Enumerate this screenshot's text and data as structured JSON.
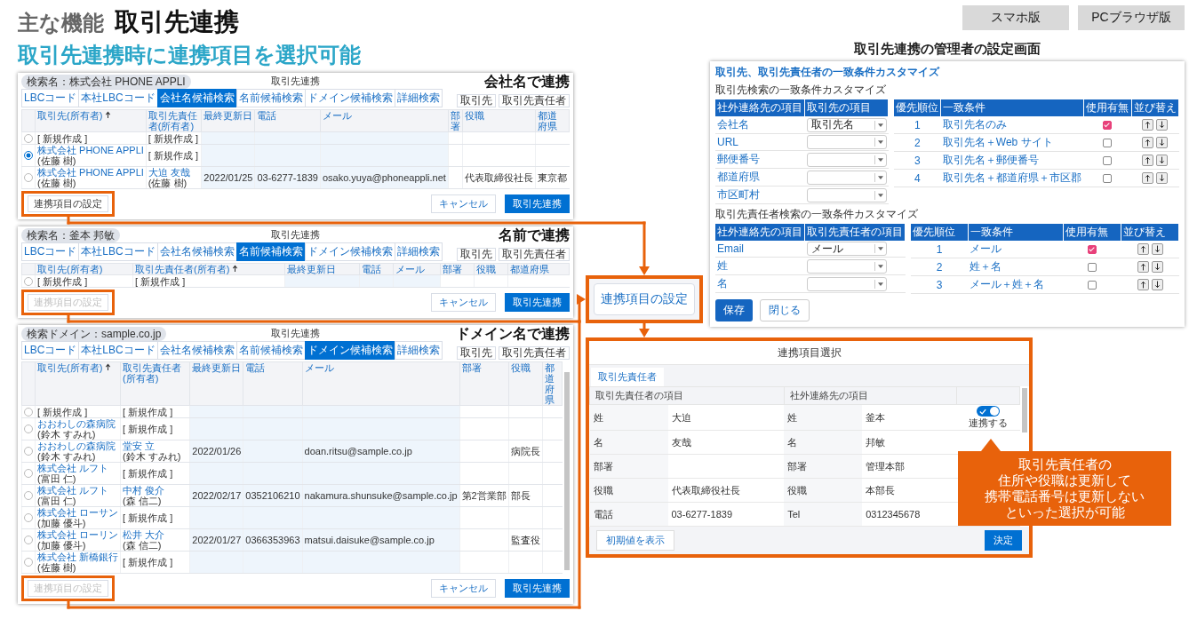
{
  "header": {
    "category": "主な機能",
    "title": "取引先連携",
    "buttons": [
      {
        "label": "スマホ版"
      },
      {
        "label": "PCブラウザ版"
      }
    ]
  },
  "subtitle": "取引先連携時に連携項目を選択可能",
  "screens": [
    {
      "caption": "会社名で連携",
      "title": "取引先連携",
      "tabs": [
        {
          "label": "LBCコード",
          "selected": false
        },
        {
          "label": "本社LBCコード",
          "selected": false
        },
        {
          "label": "会社名候補検索",
          "selected": true
        },
        {
          "label": "名前候補検索",
          "selected": false
        },
        {
          "label": "ドメイン候補検索",
          "selected": false
        },
        {
          "label": "詳細検索",
          "selected": false
        }
      ],
      "search_chip": "検索名：株式会社 PHONE APPLI",
      "filters": [
        "取引先",
        "取引先責任者"
      ],
      "columns": [
        {
          "label": "取引先(所有者)",
          "sorted": true
        },
        {
          "label": "取引先責任者(所有者)",
          "sorted": false
        },
        {
          "label": "最終更新日",
          "sorted": false
        },
        {
          "label": "電話",
          "sorted": false
        },
        {
          "label": "メール",
          "sorted": false
        },
        {
          "label": "部署",
          "sorted": false
        },
        {
          "label": "役職",
          "sorted": false
        },
        {
          "label": "都道府県",
          "sorted": false
        }
      ],
      "rows": [
        {
          "selected": false,
          "cells": [
            {
              "text": "[ 新規作成 ]",
              "kind": "text"
            },
            {
              "text": "[ 新規作成 ]",
              "kind": "text"
            },
            null,
            null,
            null,
            null,
            null,
            null
          ]
        },
        {
          "selected": true,
          "cells": [
            {
              "text": "株式会社 PHONE APPLI",
              "note": "(佐藤 樹)",
              "kind": "link"
            },
            {
              "text": "[ 新規作成 ]",
              "kind": "text"
            },
            null,
            null,
            null,
            null,
            null,
            null
          ]
        },
        {
          "selected": false,
          "cells": [
            {
              "text": "株式会社 PHONE APPLI",
              "note": "(佐藤 樹)",
              "kind": "link"
            },
            {
              "text": "大迫 友哉",
              "note": "(佐藤 樹)",
              "kind": "link"
            },
            {
              "text": "2022/01/25",
              "kind": "text"
            },
            {
              "text": "03-6277-1839",
              "kind": "text"
            },
            {
              "text": "osako.yuya@phoneappli.net",
              "kind": "text"
            },
            null,
            {
              "text": "代表取締役社長",
              "kind": "text"
            },
            {
              "text": "東京都",
              "kind": "text"
            }
          ]
        }
      ],
      "settings_button": {
        "label": "連携項目の設定",
        "disabled": false
      },
      "cancel": "キャンセル",
      "confirm": "取引先連携"
    },
    {
      "caption": "名前で連携",
      "title": "取引先連携",
      "tabs": [
        {
          "label": "LBCコード",
          "selected": false
        },
        {
          "label": "本社LBCコード",
          "selected": false
        },
        {
          "label": "会社名候補検索",
          "selected": false
        },
        {
          "label": "名前候補検索",
          "selected": true
        },
        {
          "label": "ドメイン候補検索",
          "selected": false
        },
        {
          "label": "詳細検索",
          "selected": false
        }
      ],
      "search_chip": "検索名：釜本 邦敏",
      "filters": [
        "取引先",
        "取引先責任者"
      ],
      "columns": [
        {
          "label": "取引先(所有者)",
          "sorted": false
        },
        {
          "label": "取引先責任者(所有者)",
          "sorted": true
        },
        {
          "label": "最終更新日",
          "sorted": false
        },
        {
          "label": "電話",
          "sorted": false
        },
        {
          "label": "メール",
          "sorted": false
        },
        {
          "label": "部署",
          "sorted": false
        },
        {
          "label": "役職",
          "sorted": false
        },
        {
          "label": "都道府県",
          "sorted": false
        }
      ],
      "rows": [
        {
          "selected": false,
          "cells": [
            {
              "text": "[ 新規作成 ]",
              "kind": "text"
            },
            {
              "text": "[ 新規作成 ]",
              "kind": "text"
            },
            null,
            null,
            null,
            null,
            null,
            null
          ]
        }
      ],
      "settings_button": {
        "label": "連携項目の設定",
        "disabled": true
      },
      "cancel": "キャンセル",
      "confirm": "取引先連携"
    },
    {
      "caption": "ドメイン名で連携",
      "title": "取引先連携",
      "tabs": [
        {
          "label": "LBCコード",
          "selected": false
        },
        {
          "label": "本社LBCコード",
          "selected": false
        },
        {
          "label": "会社名候補検索",
          "selected": false
        },
        {
          "label": "名前候補検索",
          "selected": false
        },
        {
          "label": "ドメイン候補検索",
          "selected": true
        },
        {
          "label": "詳細検索",
          "selected": false
        }
      ],
      "search_chip": "検索ドメイン：sample.co.jp",
      "filters": [
        "取引先",
        "取引先責任者"
      ],
      "columns": [
        {
          "label": "取引先(所有者)",
          "sorted": true
        },
        {
          "label": "取引先責任者(所有者)",
          "sorted": false
        },
        {
          "label": "最終更新日",
          "sorted": false
        },
        {
          "label": "電話",
          "sorted": false
        },
        {
          "label": "メール",
          "sorted": false
        },
        {
          "label": "部署",
          "sorted": false
        },
        {
          "label": "役職",
          "sorted": false
        },
        {
          "label": "都道府県",
          "sorted": false
        }
      ],
      "rows": [
        {
          "selected": false,
          "cells": [
            {
              "text": "[ 新規作成 ]",
              "kind": "text"
            },
            {
              "text": "[ 新規作成 ]",
              "kind": "text"
            },
            null,
            null,
            null,
            null,
            null,
            null
          ]
        },
        {
          "selected": false,
          "cells": [
            {
              "text": "おおわしの森病院",
              "note": "(鈴木 すみれ)",
              "kind": "link"
            },
            {
              "text": "[ 新規作成 ]",
              "kind": "text"
            },
            null,
            null,
            null,
            null,
            null,
            null
          ]
        },
        {
          "selected": false,
          "cells": [
            {
              "text": "おおわしの森病院",
              "note": "(鈴木 すみれ)",
              "kind": "link"
            },
            {
              "text": "堂安 立",
              "note": "(鈴木 すみれ)",
              "kind": "link"
            },
            {
              "text": "2022/01/26",
              "kind": "text"
            },
            null,
            {
              "text": "doan.ritsu@sample.co.jp",
              "kind": "text"
            },
            null,
            {
              "text": "病院長",
              "kind": "text"
            },
            null
          ]
        },
        {
          "selected": false,
          "cells": [
            {
              "text": "株式会社 ルフト",
              "note": "(富田 仁)",
              "kind": "link"
            },
            {
              "text": "[ 新規作成 ]",
              "kind": "text"
            },
            null,
            null,
            null,
            null,
            null,
            null
          ]
        },
        {
          "selected": false,
          "cells": [
            {
              "text": "株式会社 ルフト",
              "note": "(富田 仁)",
              "kind": "link"
            },
            {
              "text": "中村 俊介",
              "note": "(森 信二)",
              "kind": "link"
            },
            {
              "text": "2022/02/17",
              "kind": "text"
            },
            {
              "text": "0352106210",
              "kind": "text"
            },
            {
              "text": "nakamura.shunsuke@sample.co.jp",
              "kind": "text"
            },
            {
              "text": "第2営業部",
              "kind": "text"
            },
            {
              "text": "部長",
              "kind": "text"
            },
            null
          ]
        },
        {
          "selected": false,
          "cells": [
            {
              "text": "株式会社 ローサン",
              "note": "(加藤 優斗)",
              "kind": "link"
            },
            {
              "text": "[ 新規作成 ]",
              "kind": "text"
            },
            null,
            null,
            null,
            null,
            null,
            null
          ]
        },
        {
          "selected": false,
          "cells": [
            {
              "text": "株式会社 ローリン",
              "note": "(加藤 優斗)",
              "kind": "link"
            },
            {
              "text": "松井 大介",
              "note": "(森 信二)",
              "kind": "link"
            },
            {
              "text": "2022/01/27",
              "kind": "text"
            },
            {
              "text": "0366353963",
              "kind": "text"
            },
            {
              "text": "matsui.daisuke@sample.co.jp",
              "kind": "text"
            },
            null,
            {
              "text": "監査役",
              "kind": "text"
            },
            null
          ]
        },
        {
          "selected": false,
          "cells": [
            {
              "text": "株式会社 新橋銀行",
              "note": "(佐藤 樹)",
              "kind": "link"
            },
            {
              "text": "[ 新規作成 ]",
              "kind": "text"
            },
            null,
            null,
            null,
            null,
            null,
            null
          ]
        }
      ],
      "settings_button": {
        "label": "連携項目の設定",
        "disabled": true
      },
      "cancel": "キャンセル",
      "confirm": "取引先連携"
    }
  ],
  "settings_entry": {
    "label": "連携項目の設定"
  },
  "admin": {
    "caption": "取引先連携の管理者の設定画面",
    "title": "取引先、取引先責任者の一致条件カスタマイズ",
    "sections": [
      {
        "heading": "取引先検索の一致条件カスタマイズ",
        "map_columns": [
          "社外連絡先の項目",
          "取引先の項目"
        ],
        "mappings": [
          {
            "field": "会社名",
            "value": "取引先名"
          },
          {
            "field": "URL"
          },
          {
            "field": "郵便番号"
          },
          {
            "field": "都道府県"
          },
          {
            "field": "市区町村"
          }
        ],
        "rule_columns": [
          "優先順位",
          "一致条件",
          "使用有無",
          "並び替え"
        ],
        "rules": [
          {
            "rank": "1",
            "condition": "取引先名のみ",
            "checked": true
          },
          {
            "rank": "2",
            "condition": "取引先名＋Web サイト",
            "checked": false
          },
          {
            "rank": "3",
            "condition": "取引先名＋郵便番号",
            "checked": false
          },
          {
            "rank": "4",
            "condition": "取引先名＋都道府県＋市区郡",
            "checked": false
          }
        ]
      },
      {
        "heading": "取引先責任者検索の一致条件カスタマイズ",
        "map_columns": [
          "社外連絡先の項目",
          "取引先責任者の項目"
        ],
        "mappings": [
          {
            "field": "Email",
            "value": "メール"
          },
          {
            "field": "姓"
          },
          {
            "field": "名"
          }
        ],
        "rule_columns": [
          "優先順位",
          "一致条件",
          "使用有無",
          "並び替え"
        ],
        "rules": [
          {
            "rank": "1",
            "condition": "メール",
            "checked": true
          },
          {
            "rank": "2",
            "condition": "姓＋名",
            "checked": false
          },
          {
            "rank": "3",
            "condition": "メール＋姓＋名",
            "checked": false
          }
        ]
      }
    ],
    "buttons": [
      {
        "label": "保存",
        "primary": true
      },
      {
        "label": "閉じる",
        "primary": false
      }
    ]
  },
  "selection": {
    "title": "連携項目選択",
    "tab": "取引先責任者",
    "columns": [
      "取引先責任者の項目",
      "社外連絡先の項目"
    ],
    "rows": [
      {
        "label": "姓",
        "value": "大迫",
        "ext_label": "姓",
        "ext_value": "釜本",
        "toggle": {
          "on": true,
          "label": "連携する"
        }
      },
      {
        "label": "名",
        "value": "友哉",
        "ext_label": "名",
        "ext_value": "邦敏"
      },
      {
        "label": "部署",
        "ext_label": "部署",
        "ext_value": "管理本部"
      },
      {
        "label": "役職",
        "value": "代表取締役社長",
        "ext_label": "役職",
        "ext_value": "本部長"
      },
      {
        "label": "電話",
        "value": "03-6277-1839",
        "ext_label": "Tel",
        "ext_value": "0312345678"
      }
    ],
    "buttons": [
      {
        "label": "初期値を表示",
        "primary": false
      },
      {
        "label": "決定",
        "primary": true
      }
    ],
    "callout_lines": [
      "取引先責任者の",
      "住所や役職は更新して",
      "携帯電話番号は更新しない",
      "といった選択が可能"
    ]
  }
}
